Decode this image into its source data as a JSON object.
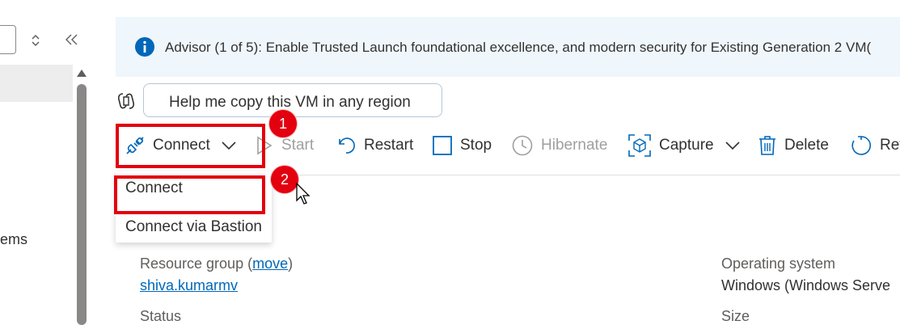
{
  "advisor": {
    "text": "Advisor (1 of 5): Enable Trusted Launch foundational excellence, and modern security for Existing Generation 2 VM("
  },
  "copilot": {
    "suggestion": "Help me copy this VM in any region"
  },
  "sidebar": {
    "partial_item": "ems"
  },
  "toolbar": {
    "connect": "Connect",
    "start": "Start",
    "restart": "Restart",
    "stop": "Stop",
    "hibernate": "Hibernate",
    "capture": "Capture",
    "delete": "Delete",
    "refresh": "Ref"
  },
  "connect_menu": {
    "items": [
      "Connect",
      "Connect via Bastion"
    ]
  },
  "annotations": {
    "step1": "1",
    "step2": "2"
  },
  "essentials": {
    "resource_group_label": "Resource group (",
    "resource_group_move": "move",
    "resource_group_close": ")",
    "resource_group_value": "shiva.kumarmv",
    "status_label": "Status",
    "os_label": "Operating system",
    "os_value": "Windows (Windows Serve",
    "size_label": "Size"
  },
  "colors": {
    "accent": "#0067b8",
    "highlight": "#e3000f",
    "banner_bg": "#eff6fc",
    "disabled": "#a19f9d"
  }
}
